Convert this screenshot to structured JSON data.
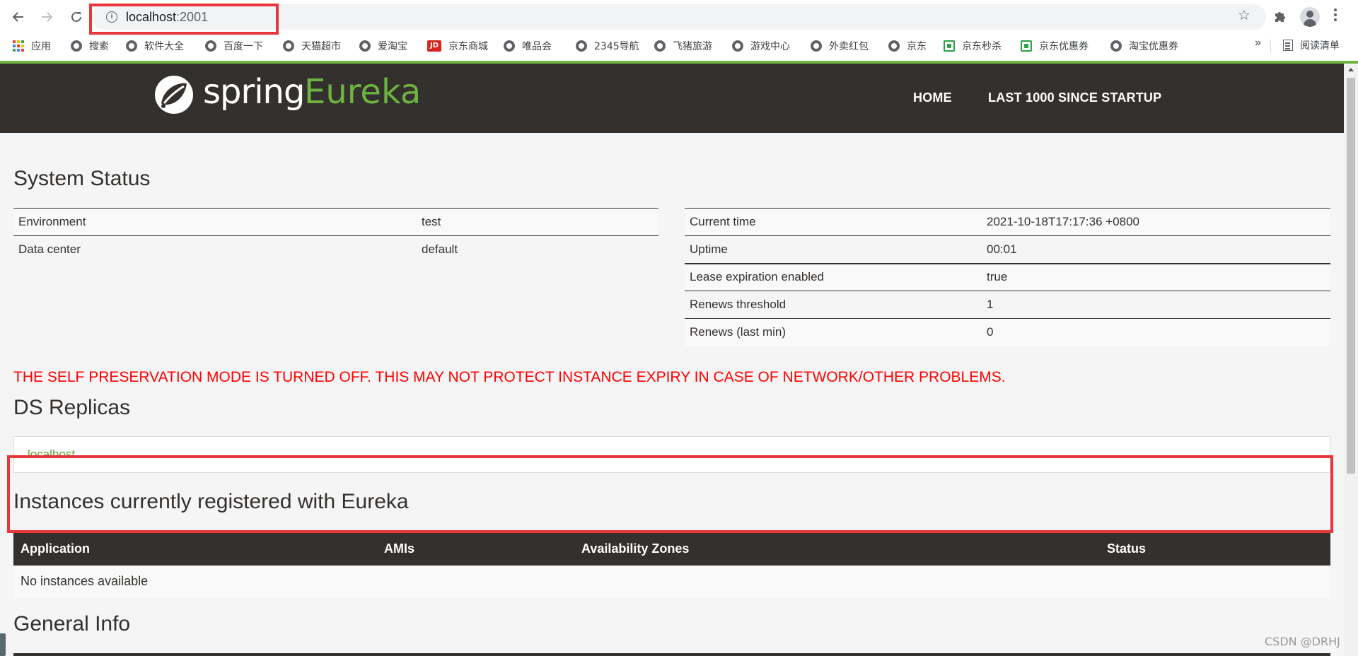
{
  "browser": {
    "url_host": "localhost",
    "url_port": ":2001",
    "bookmarks": [
      {
        "label": "应用",
        "icon": "apps-grid-icon"
      },
      {
        "label": "搜索",
        "icon": "globe-icon"
      },
      {
        "label": "软件大全",
        "icon": "globe-icon"
      },
      {
        "label": "百度一下",
        "icon": "globe-icon"
      },
      {
        "label": "天猫超市",
        "icon": "globe-icon"
      },
      {
        "label": "爱淘宝",
        "icon": "globe-icon"
      },
      {
        "label": "京东商城",
        "icon": "jd-icon"
      },
      {
        "label": "唯品会",
        "icon": "globe-icon"
      },
      {
        "label": "2345导航",
        "icon": "globe-icon"
      },
      {
        "label": "飞猪旅游",
        "icon": "globe-icon"
      },
      {
        "label": "游戏中心",
        "icon": "globe-icon"
      },
      {
        "label": "外卖红包",
        "icon": "globe-icon"
      },
      {
        "label": "京东",
        "icon": "globe-icon"
      },
      {
        "label": "京东秒杀",
        "icon": "green-icon"
      },
      {
        "label": "京东优惠券",
        "icon": "green-icon"
      },
      {
        "label": "淘宝优惠券",
        "icon": "globe-icon"
      }
    ],
    "more": "»",
    "reading_list": "阅读清单",
    "jd_icon_text": "JD"
  },
  "header": {
    "logo_spring": "spring",
    "logo_eureka": "Eureka",
    "nav": [
      "HOME",
      "LAST 1000 SINCE STARTUP"
    ]
  },
  "system_status": {
    "title": "System Status",
    "left": [
      [
        "Environment",
        "test"
      ],
      [
        "Data center",
        "default"
      ]
    ],
    "right": [
      [
        "Current time",
        "2021-10-18T17:17:36 +0800"
      ],
      [
        "Uptime",
        "00:01"
      ],
      [
        "Lease expiration enabled",
        "true"
      ],
      [
        "Renews threshold",
        "1"
      ],
      [
        "Renews (last min)",
        "0"
      ]
    ]
  },
  "warning": "THE SELF PRESERVATION MODE IS TURNED OFF. THIS MAY NOT PROTECT INSTANCE EXPIRY IN CASE OF NETWORK/OTHER PROBLEMS.",
  "ds_replicas": {
    "title": "DS Replicas",
    "items": [
      "localhost"
    ]
  },
  "instances": {
    "title": "Instances currently registered with Eureka",
    "columns": [
      "Application",
      "AMIs",
      "Availability Zones",
      "Status"
    ],
    "empty": "No instances available"
  },
  "general_info": {
    "title": "General Info"
  },
  "watermark": "CSDN @DRHJ",
  "colors": {
    "header": "#34302d",
    "spring_green": "#6db33f",
    "warning_red": "#ff0000",
    "annotation_red": "#e8363d"
  }
}
